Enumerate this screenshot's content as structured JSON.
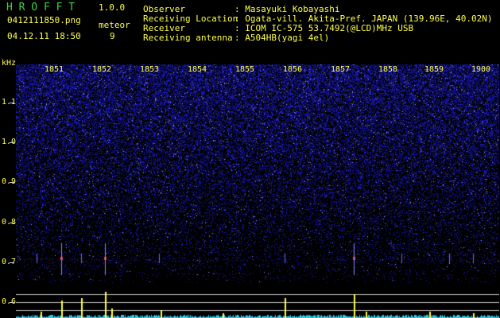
{
  "header": {
    "app_title": "H R O F F T",
    "version": "1.0.0",
    "filename": "0412111850.png",
    "datetime": "04.12.11 18:50",
    "meteor_label": "meteor",
    "meteor_count": "9"
  },
  "info": [
    {
      "key": "Observer",
      "value": ": Masayuki Kobayashi"
    },
    {
      "key": "Receiving Location",
      "value": ": Ogata-vill. Akita-Pref. JAPAN (139.96E, 40.02N)"
    },
    {
      "key": "Receiver",
      "value": ": ICOM IC-575 53.7492(@LCD)MHz USB"
    },
    {
      "key": "Receiving antenna",
      "value": ": A504HB(yagi 4el)"
    }
  ],
  "axis": {
    "y_unit": "kHz",
    "y_labels": [
      "1.1",
      "1.0",
      "0.9",
      "0.8",
      "0.7",
      "0.6"
    ],
    "x_labels": [
      "1851",
      "1852",
      "1853",
      "1854",
      "1855",
      "1856",
      "1857",
      "1858",
      "1859",
      "1900"
    ]
  },
  "colors": {
    "background": "#000000",
    "noise": "#1a1ab4",
    "text_yellow": "#ffff4a",
    "title_green": "#3fd43f",
    "meteor_red": "#ff3030",
    "trace_cyan": "#33c8e6",
    "trace_peak": "#ffff33"
  }
}
